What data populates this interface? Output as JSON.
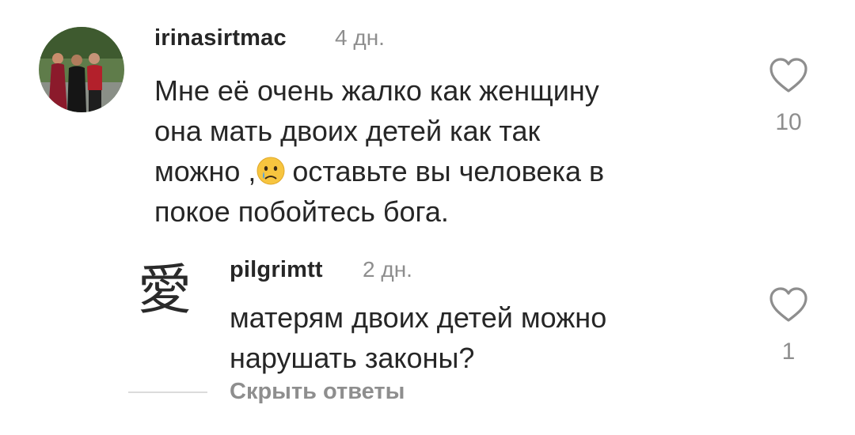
{
  "comments": [
    {
      "username": "irinasirtmac",
      "time": "4 дн.",
      "text_lines": [
        "Мне её очень жалко как женщину",
        "она мать двоих детей как так",
        "можно ,",
        "оставьте  вы человека в",
        "покое побойтесь бога."
      ],
      "emoji": "crying-face",
      "likes": "10"
    },
    {
      "username": "pilgrimtt",
      "time": "2 дн.",
      "text_lines": [
        "матерям двоих детей можно",
        "нарушать законы?"
      ],
      "avatar_glyph": "愛",
      "likes": "1"
    }
  ],
  "hide_replies": "Скрыть ответы",
  "colors": {
    "text": "#262626",
    "muted": "#8e8e8e",
    "divider": "#dbdbdb"
  }
}
